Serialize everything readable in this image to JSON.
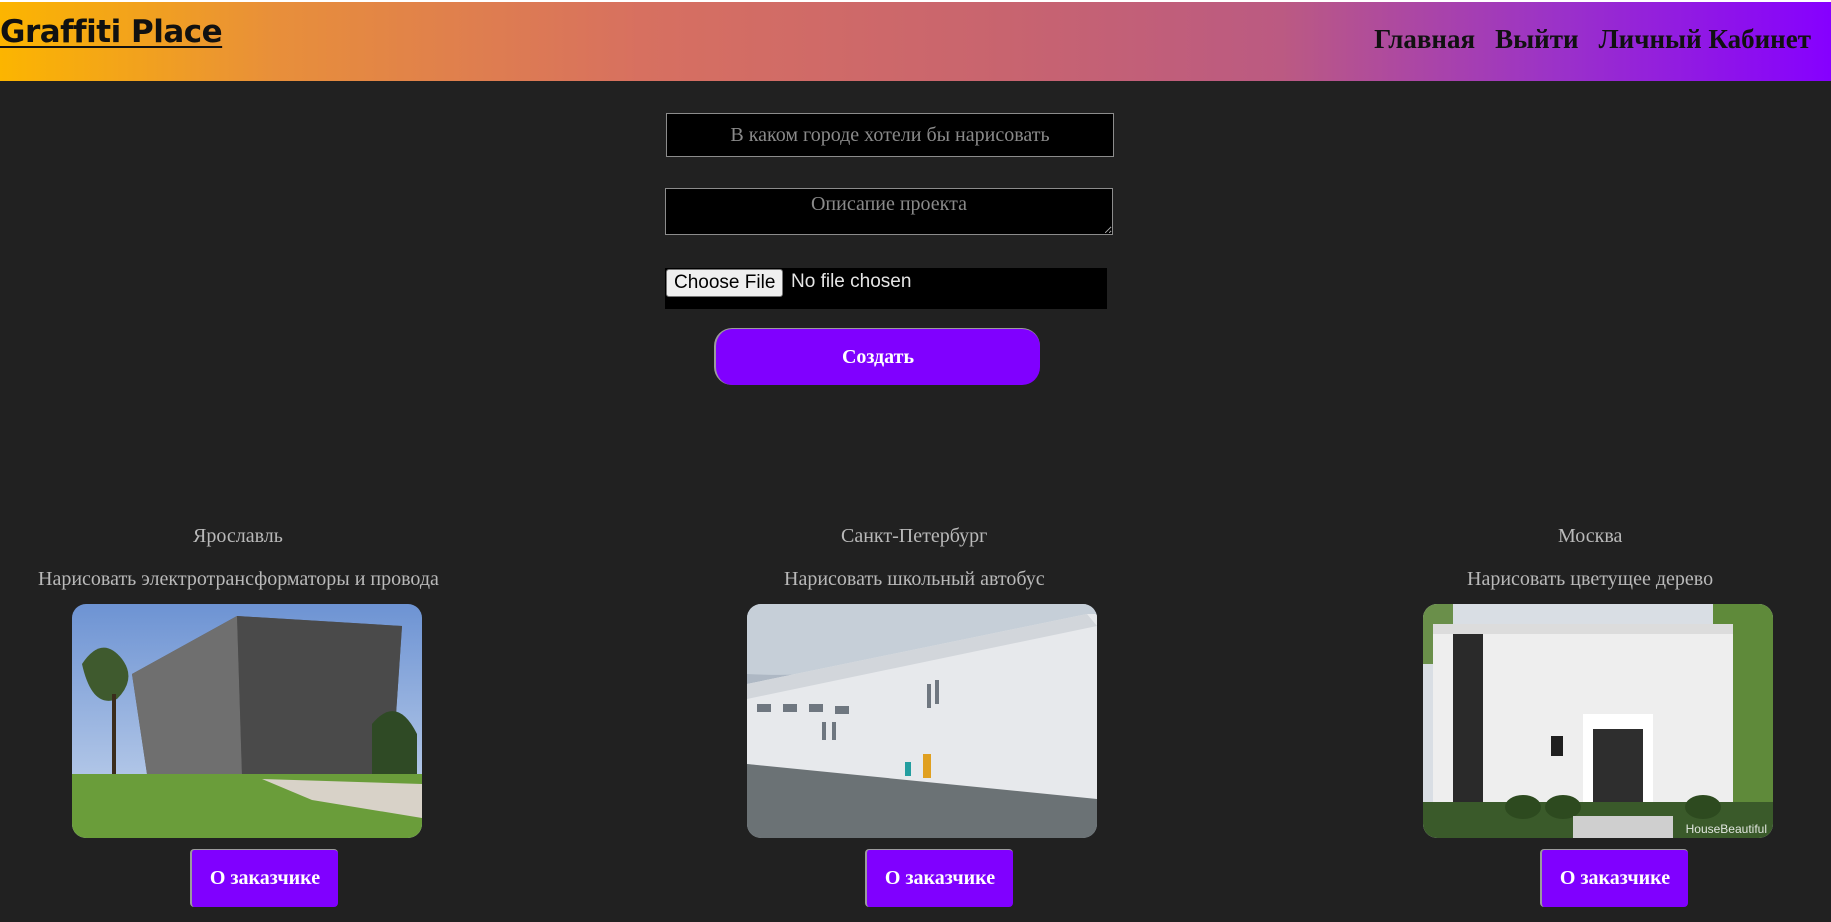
{
  "header": {
    "logo": "Graffiti Place",
    "nav": [
      "Главная",
      "Выйти",
      "Личный Кабинет"
    ]
  },
  "form": {
    "city_placeholder": "В каком городе хотели бы нарисовать",
    "description_placeholder": "Описапие проекта",
    "file_button": "Choose File",
    "file_status": "No file chosen",
    "submit_label": "Создать"
  },
  "cards": [
    {
      "city": "Ярославль",
      "description": "Нарисовать электротрансформаторы и провода",
      "button": "О заказчике"
    },
    {
      "city": "Санкт-Петербург",
      "description": "Нарисовать школьный автобус",
      "button": "О заказчике"
    },
    {
      "city": "Москва",
      "description": "Нарисовать цветущее дерево",
      "button": "О заказчике",
      "watermark": "HouseBeautiful"
    }
  ],
  "colors": {
    "accent": "#8000ff",
    "background": "#212121",
    "header_gradient_start": "#fcb500",
    "header_gradient_end": "#8600ff"
  }
}
